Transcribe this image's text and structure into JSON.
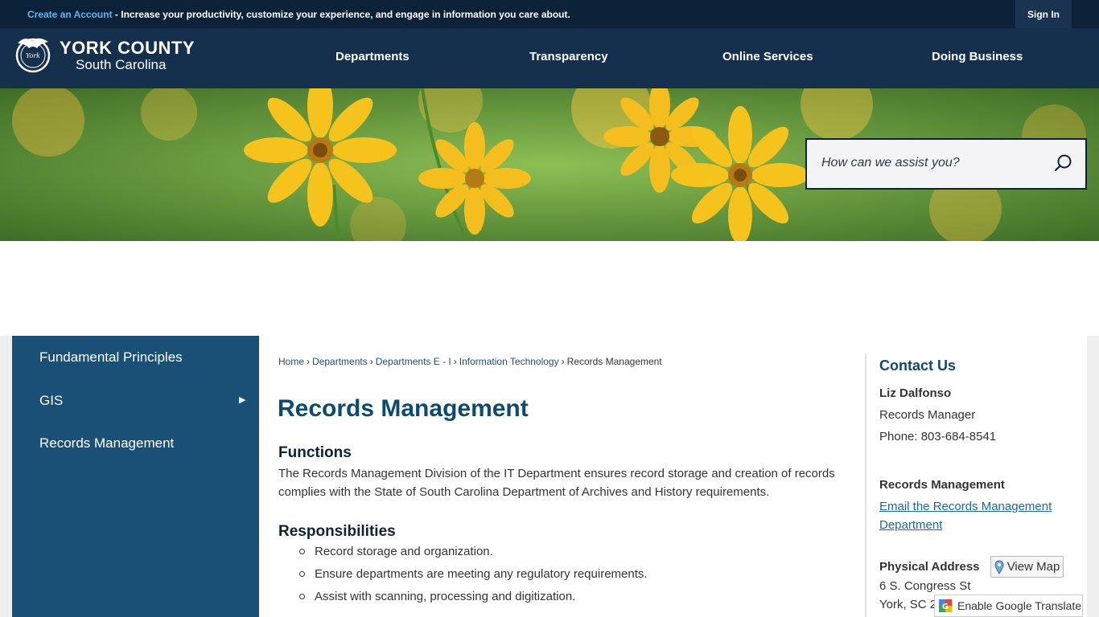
{
  "topbar": {
    "create_account": "Create an Account",
    "promo_text": " - Increase your productivity, customize your experience, and engage in information you care about.",
    "sign_in": "Sign In"
  },
  "brand": {
    "title": "YORK COUNTY",
    "subtitle": "South Carolina"
  },
  "nav": {
    "items": [
      "Departments",
      "Transparency",
      "Online Services",
      "Doing Business"
    ]
  },
  "search": {
    "placeholder": "How can we assist you?"
  },
  "sidebar": {
    "items": [
      {
        "label": "Fundamental Principles"
      },
      {
        "label": "GIS"
      },
      {
        "label": "Records Management"
      }
    ]
  },
  "breadcrumb": {
    "items": [
      "Home",
      "Departments",
      "Departments E - I",
      "Information Technology"
    ],
    "current": "Records Management"
  },
  "main": {
    "title": "Records Management",
    "functions_heading": "Functions",
    "functions_text": "The Records Management Division of the IT Department ensures record storage and creation of records complies with the State of South Carolina Department of Archives and History requirements.",
    "responsibilities_heading": "Responsibilities",
    "responsibilities": [
      "Record storage and organization.",
      "Ensure departments are meeting any regulatory requirements.",
      "Assist with scanning, processing and digitization."
    ]
  },
  "contact": {
    "title": "Contact Us",
    "name": "Liz Dalfonso",
    "role": "Records Manager",
    "phone": "Phone: 803-684-8541",
    "dept": "Records Management",
    "email_line1": "Email the Records Management",
    "email_line2": "Department",
    "address_label": "Physical Address",
    "view_map": "View Map",
    "street": "6 S. Congress St",
    "city": "York, SC 2"
  },
  "translate": {
    "label": "Enable Google Translate"
  },
  "colors": {
    "topbar": "#0b2238",
    "header": "#14304d",
    "sidebar": "#1a5076",
    "title": "#0d4a72",
    "link": "#1a6a9a"
  }
}
